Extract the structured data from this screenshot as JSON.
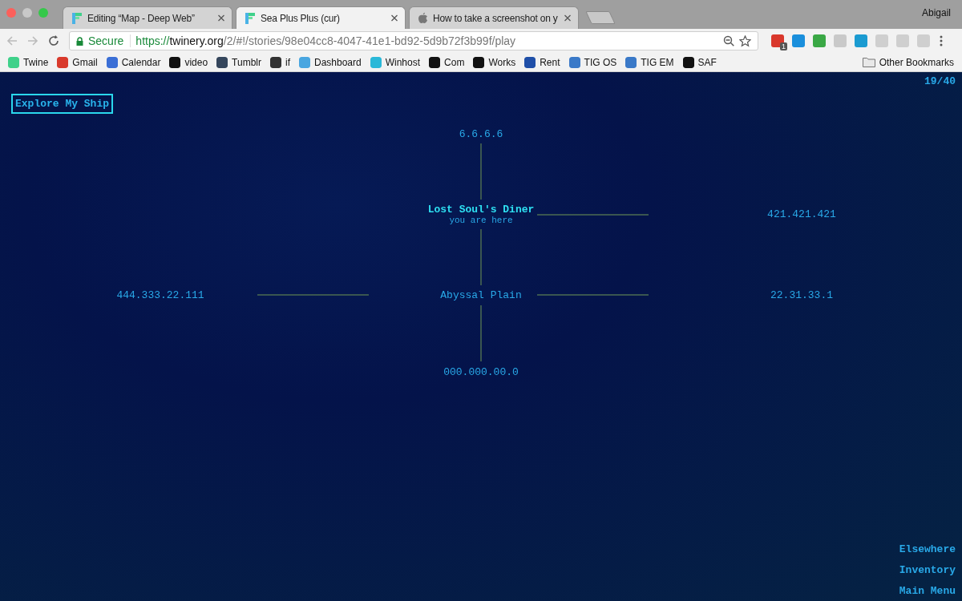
{
  "tabs": [
    {
      "title": "Editing “Map - Deep Web”",
      "selected": false,
      "kind": "twine"
    },
    {
      "title": "Sea Plus Plus (cur)",
      "selected": true,
      "kind": "twine"
    },
    {
      "title": "How to take a screenshot on y",
      "selected": false,
      "kind": "apple"
    }
  ],
  "profile": "Abigail",
  "address": {
    "secure_label": "Secure",
    "scheme": "https://",
    "host": "twinery.org",
    "path": "/2/#!/stories/98e04cc8-4047-41e1-bd92-5d9b72f3b99f/play"
  },
  "extension_badge": "1",
  "bookmarks": [
    {
      "label": "Twine"
    },
    {
      "label": "Gmail"
    },
    {
      "label": "Calendar"
    },
    {
      "label": "video"
    },
    {
      "label": "Tumblr"
    },
    {
      "label": "if"
    },
    {
      "label": "Dashboard"
    },
    {
      "label": "Winhost"
    },
    {
      "label": "Com"
    },
    {
      "label": "Works"
    },
    {
      "label": "Rent"
    },
    {
      "label": "TIG OS"
    },
    {
      "label": "TIG EM"
    },
    {
      "label": "SAF"
    }
  ],
  "other_bookmarks": "Other Bookmarks",
  "story": {
    "link": "Explore My Ship",
    "counter": "19/40",
    "map": [
      [
        {
          "kind": "empty"
        },
        {
          "kind": "empty"
        },
        {
          "kind": "node",
          "label": "6.6.6.6",
          "current": false
        },
        {
          "kind": "empty"
        },
        {
          "kind": "empty"
        }
      ],
      [
        {
          "kind": "empty"
        },
        {
          "kind": "empty"
        },
        {
          "kind": "vline"
        },
        {
          "kind": "empty"
        },
        {
          "kind": "empty"
        }
      ],
      [
        {
          "kind": "empty"
        },
        {
          "kind": "empty"
        },
        {
          "kind": "node",
          "label": "Lost Soul's Diner",
          "note": "you are here",
          "current": true
        },
        {
          "kind": "hline"
        },
        {
          "kind": "node",
          "label": "421.421.421",
          "current": false
        }
      ],
      [
        {
          "kind": "empty"
        },
        {
          "kind": "empty"
        },
        {
          "kind": "vline"
        },
        {
          "kind": "empty"
        },
        {
          "kind": "empty"
        }
      ],
      [
        {
          "kind": "node",
          "label": "444.333.22.111",
          "current": false
        },
        {
          "kind": "hline"
        },
        {
          "kind": "node",
          "label": "Abyssal Plain",
          "current": false
        },
        {
          "kind": "hline"
        },
        {
          "kind": "node",
          "label": "22.31.33.1",
          "current": false
        }
      ],
      [
        {
          "kind": "empty"
        },
        {
          "kind": "empty"
        },
        {
          "kind": "vline"
        },
        {
          "kind": "empty"
        },
        {
          "kind": "empty"
        }
      ],
      [
        {
          "kind": "empty"
        },
        {
          "kind": "empty"
        },
        {
          "kind": "node",
          "label": "000.000.00.0",
          "current": false
        },
        {
          "kind": "empty"
        },
        {
          "kind": "empty"
        }
      ]
    ],
    "menu": [
      {
        "label": "Elsewhere"
      },
      {
        "label": "Inventory"
      },
      {
        "label": "Main Menu"
      }
    ]
  }
}
